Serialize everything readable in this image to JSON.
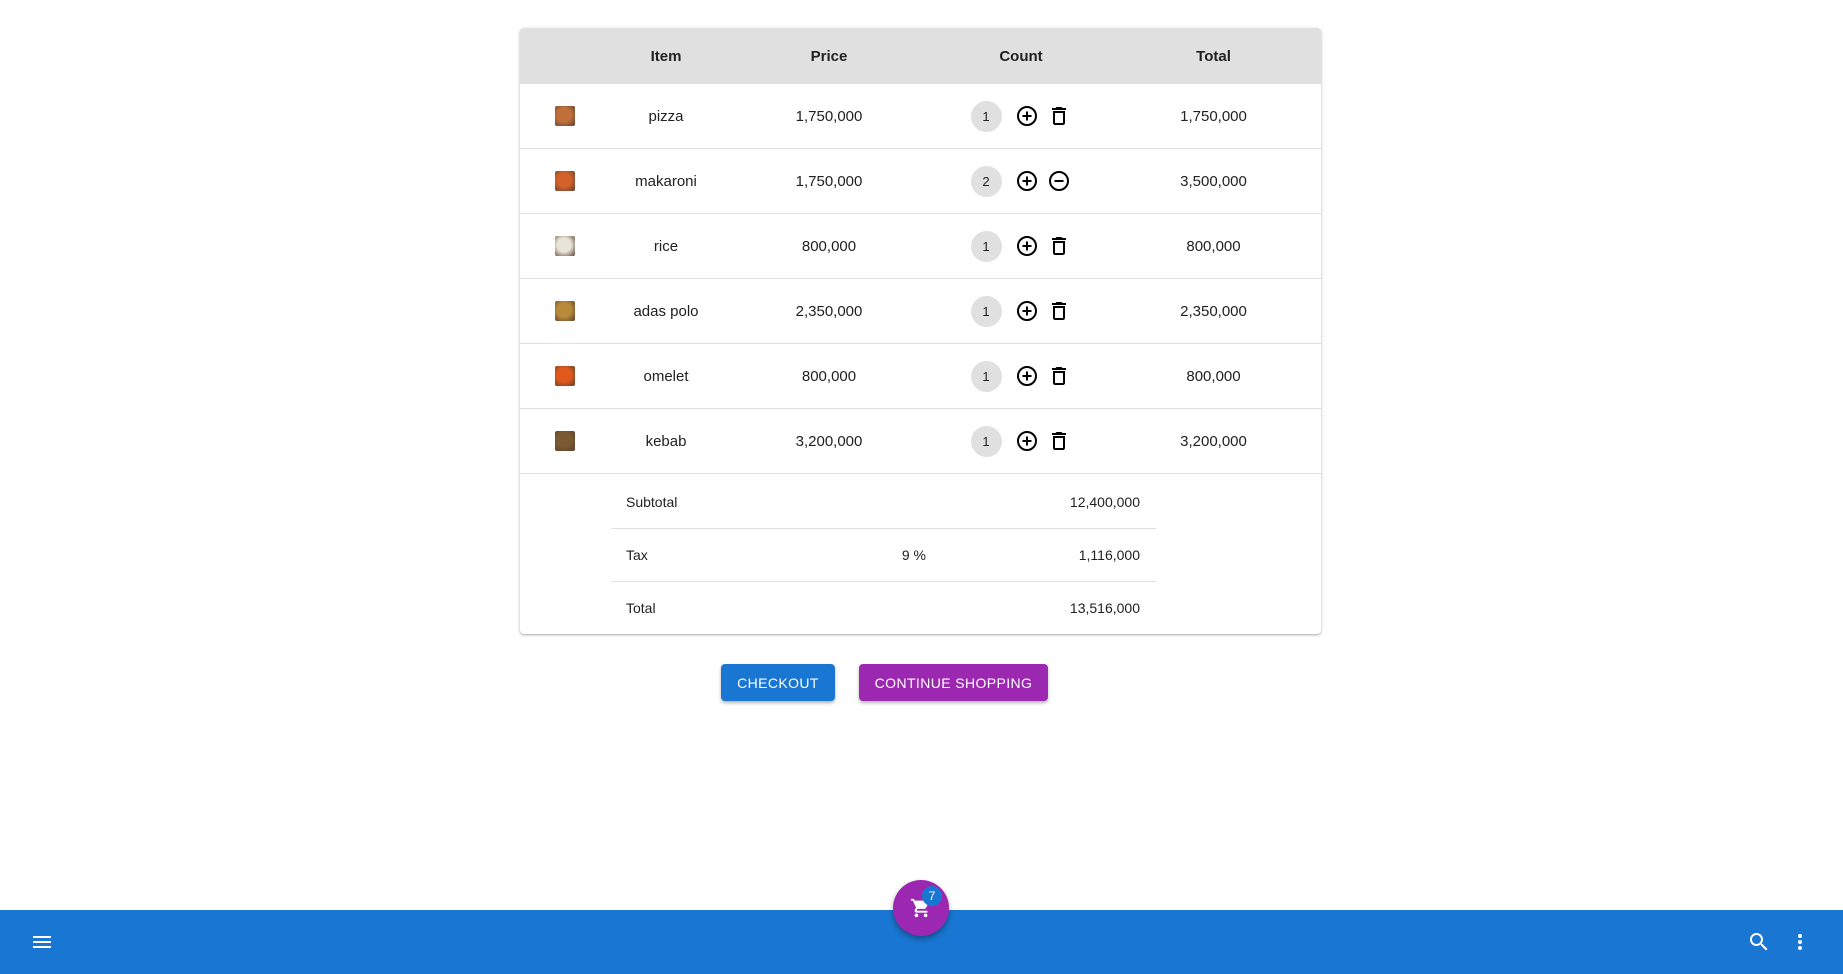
{
  "table": {
    "headers": {
      "image": "",
      "item": "Item",
      "price": "Price",
      "count": "Count",
      "total": "Total"
    },
    "rows": [
      {
        "name": "pizza",
        "price": "1,750,000",
        "count": "1",
        "total": "1,750,000",
        "secondary_action": "delete",
        "thumb_color": "#c0703a"
      },
      {
        "name": "makaroni",
        "price": "1,750,000",
        "count": "2",
        "total": "3,500,000",
        "secondary_action": "decrement",
        "thumb_color": "#d4602a"
      },
      {
        "name": "rice",
        "price": "800,000",
        "count": "1",
        "total": "800,000",
        "secondary_action": "delete",
        "thumb_color": "#e8e4d8"
      },
      {
        "name": "adas polo",
        "price": "2,350,000",
        "count": "1",
        "total": "2,350,000",
        "secondary_action": "delete",
        "thumb_color": "#b88a3a"
      },
      {
        "name": "omelet",
        "price": "800,000",
        "count": "1",
        "total": "800,000",
        "secondary_action": "delete",
        "thumb_color": "#e0581c"
      },
      {
        "name": "kebab",
        "price": "3,200,000",
        "count": "1",
        "total": "3,200,000",
        "secondary_action": "delete",
        "thumb_color": "#7a5a30"
      }
    ]
  },
  "summary": {
    "subtotal": {
      "label": "Subtotal",
      "value": "12,400,000"
    },
    "tax": {
      "label": "Tax",
      "rate": "9 %",
      "value": "1,116,000"
    },
    "total": {
      "label": "Total",
      "value": "13,516,000"
    }
  },
  "actions": {
    "checkout_label": "CHECKOUT",
    "continue_label": "CONTINUE SHOPPING"
  },
  "cart_fab": {
    "badge_count": "7",
    "icon": "cart-icon"
  },
  "appbar": {
    "menu_icon": "menu-icon",
    "search_icon": "search-icon",
    "more_icon": "more-vert-icon"
  },
  "colors": {
    "primary": "#1976d2",
    "secondary": "#9c27b0",
    "header_bg": "#e0e0e0",
    "chip_bg": "#e0e0e0"
  }
}
